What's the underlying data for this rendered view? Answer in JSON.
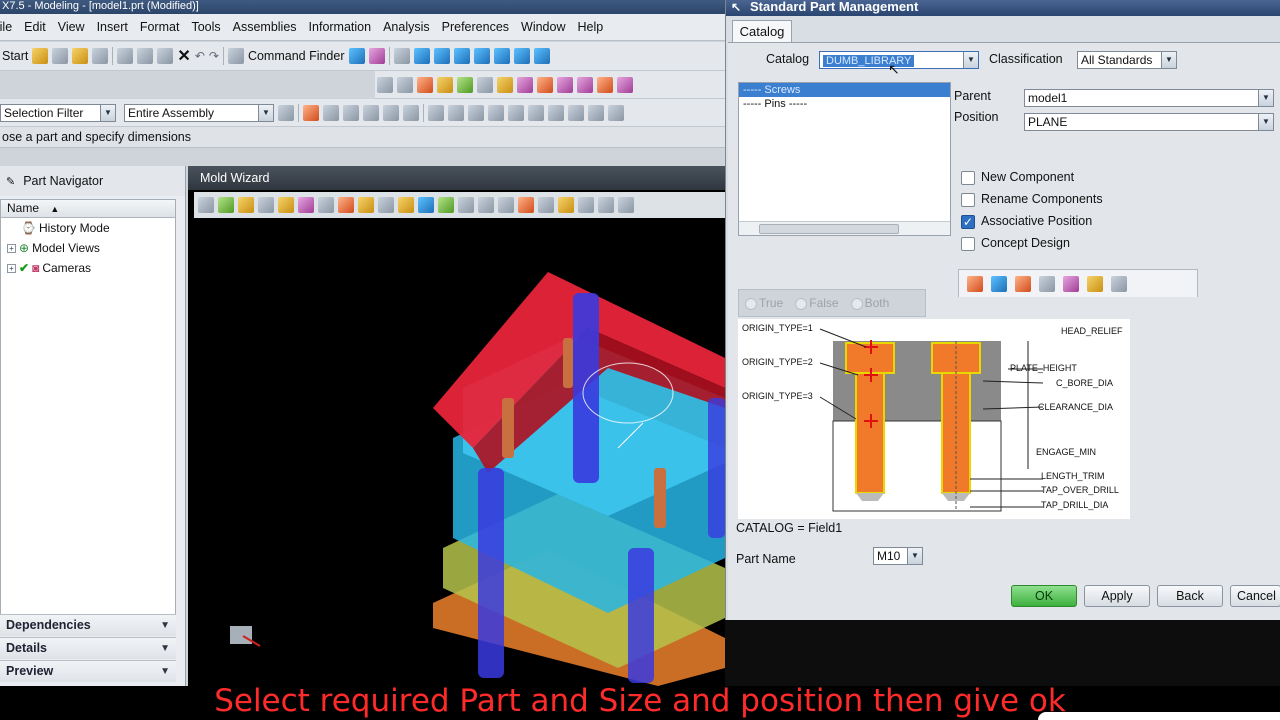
{
  "window": {
    "title": "X7.5 - Modeling - [model1.prt (Modified)]"
  },
  "menu": [
    "File",
    "Edit",
    "View",
    "Insert",
    "Format",
    "Tools",
    "Assemblies",
    "Information",
    "Analysis",
    "Preferences",
    "Window",
    "Help"
  ],
  "toolbar": {
    "start_label": "Start",
    "command_finder_label": "Command Finder",
    "selection_filter_value": "Selection Filter",
    "scope_value": "Entire Assembly"
  },
  "status_prompt": "ose a part and specify dimensions",
  "navigator": {
    "title": "Part Navigator",
    "column": "Name",
    "items": [
      "History Mode",
      "Model Views",
      "Cameras"
    ],
    "panels": [
      "Dependencies",
      "Details",
      "Preview"
    ]
  },
  "viewport": {
    "title": "Mold Wizard"
  },
  "dialog": {
    "title": "Standard Part Management",
    "tab": "Catalog",
    "catalog_label": "Catalog",
    "catalog_value": "DUMB_LIBRARY",
    "classification_label": "Classification",
    "classification_value": "All Standards",
    "tree": [
      "Screws",
      "Pins"
    ],
    "parent_label": "Parent",
    "parent_value": "model1",
    "position_label": "Position",
    "position_value": "PLANE",
    "options": [
      {
        "label": "New Component",
        "checked": false
      },
      {
        "label": "Rename Components",
        "checked": false
      },
      {
        "label": "Associative Position",
        "checked": true
      },
      {
        "label": "Concept Design",
        "checked": false
      }
    ],
    "radios": [
      "True",
      "False",
      "Both"
    ],
    "diagram_labels": {
      "origin1": "ORIGIN_TYPE=1",
      "origin2": "ORIGIN_TYPE=2",
      "origin3": "ORIGIN_TYPE=3",
      "head_relief": "HEAD_RELIEF",
      "plate_height": "PLATE_HEIGHT",
      "c_bore_dia": "C_BORE_DIA",
      "clearance_dia": "CLEARANCE_DIA",
      "engage_min": "ENGAGE_MIN",
      "length_trim": "LENGTH_TRIM",
      "tap_over_drill": "TAP_OVER_DRILL",
      "tap_drill_dia": "TAP_DRILL_DIA"
    },
    "catalog_note": "CATALOG = Field1",
    "part_name_label": "Part Name",
    "part_name_value": "M10",
    "buttons": {
      "ok": "OK",
      "apply": "Apply",
      "back": "Back",
      "cancel": "Cancel"
    }
  },
  "caption": "Select required Part and Size and position then give ok",
  "colors": {
    "caption": "#ff2b2b",
    "selection": "#3b7fd1",
    "ok_button": "#3db03d"
  }
}
